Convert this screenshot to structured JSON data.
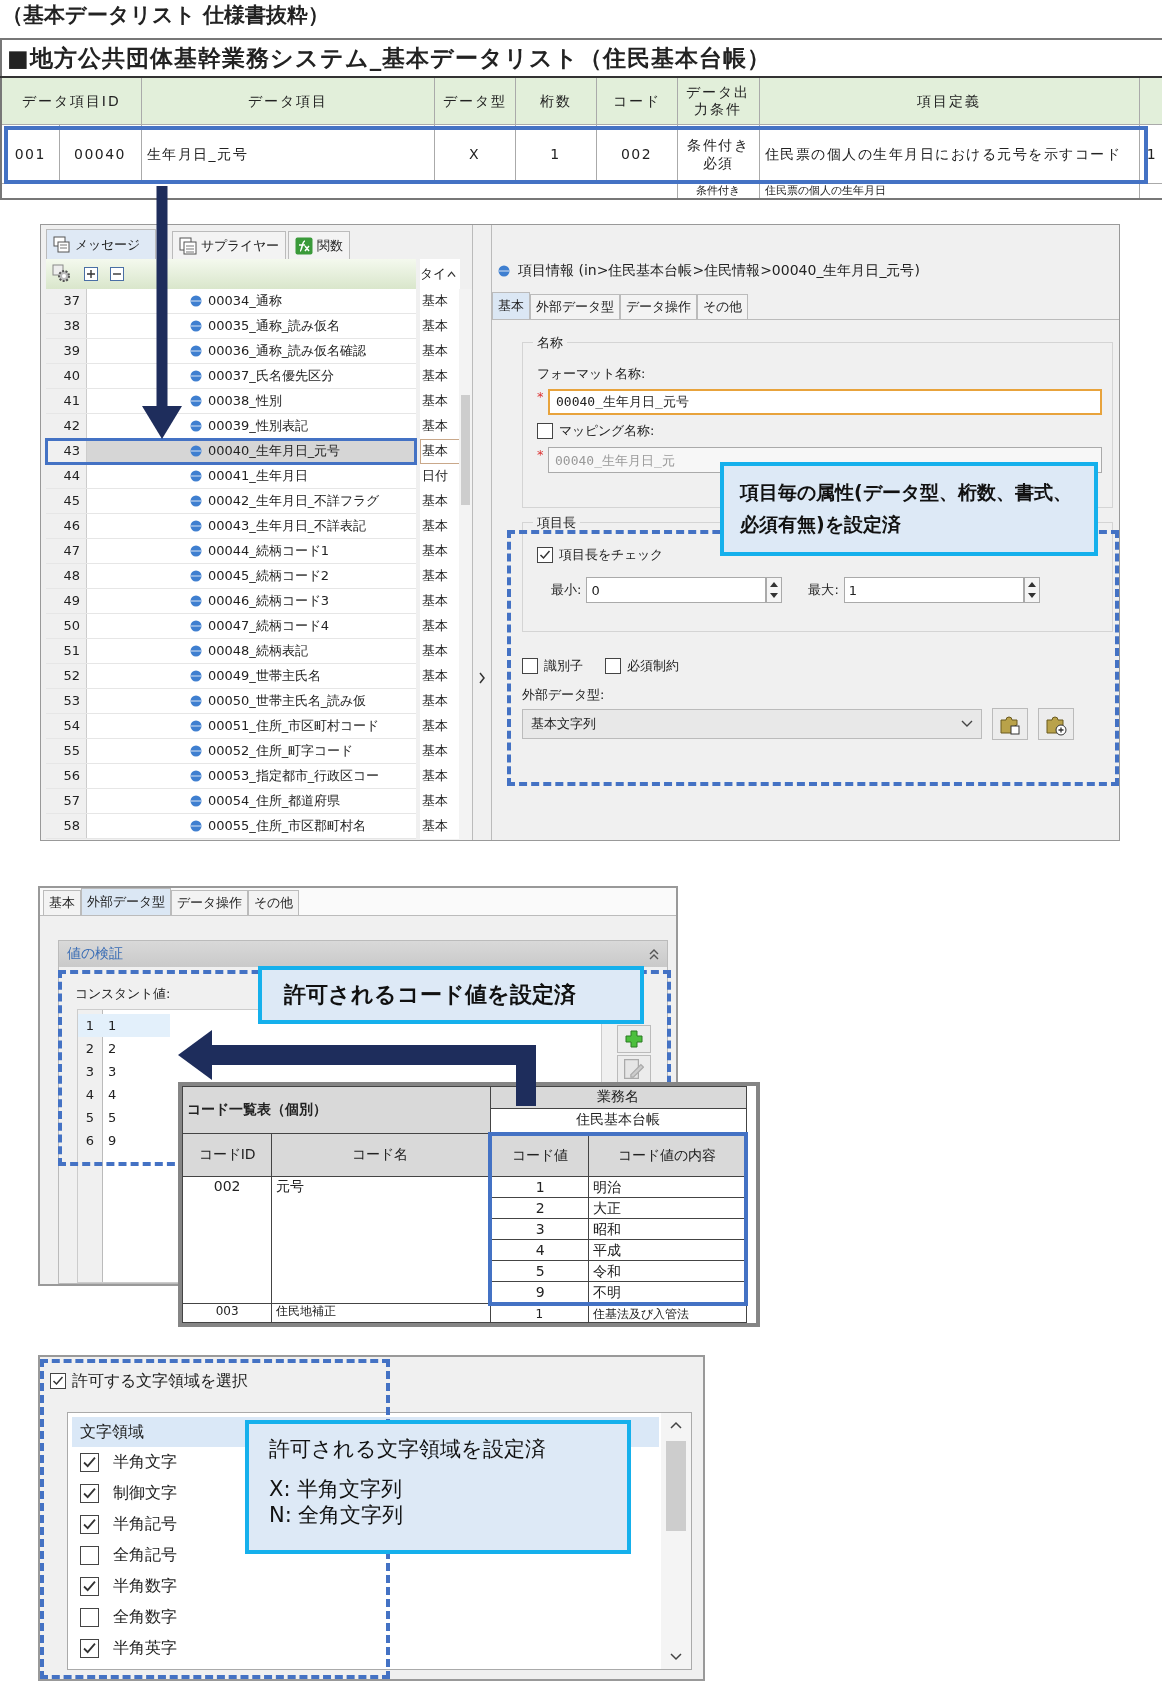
{
  "caption": "（基本データリスト 仕様書抜粋）",
  "spec_table": {
    "title": "■地方公共団体基幹業務システム_基本データリスト（住民基本台帳）",
    "columns": [
      {
        "label": "データ項目ID",
        "colspan": 2
      },
      {
        "label": "データ項目"
      },
      {
        "label": "データ型"
      },
      {
        "label": "桁数"
      },
      {
        "label": "コード"
      },
      {
        "label": "データ出力条件"
      },
      {
        "label": "項目定義"
      }
    ],
    "rows": [
      {
        "cells": [
          "001",
          "00040",
          "生年月日_元号",
          "X",
          "1",
          "002",
          "条件付き必須",
          "住民票の個人の生年月日における元号を示すコード",
          "1"
        ],
        "highlighted": true
      }
    ],
    "next_row": {
      "condition": "条件付き",
      "definition": "住民票の個人の生年月日"
    }
  },
  "editor": {
    "tool_tabs": [
      {
        "label": "メッセージ",
        "selected": true
      },
      {
        "label": "サプライヤー",
        "selected": false
      },
      {
        "label": "関数",
        "selected": false
      }
    ],
    "type_header": "タイ",
    "rows": [
      {
        "number": "37",
        "name": "00034_通称",
        "type": "基本",
        "selected": false
      },
      {
        "number": "38",
        "name": "00035_通称_読み仮名",
        "type": "基本",
        "selected": false
      },
      {
        "number": "39",
        "name": "00036_通称_読み仮名確認",
        "type": "基本",
        "selected": false
      },
      {
        "number": "40",
        "name": "00037_氏名優先区分",
        "type": "基本",
        "selected": false
      },
      {
        "number": "41",
        "name": "00038_性別",
        "type": "基本",
        "selected": false
      },
      {
        "number": "42",
        "name": "00039_性別表記",
        "type": "基本",
        "selected": false
      },
      {
        "number": "43",
        "name": "00040_生年月日_元号",
        "type": "基本",
        "selected": true
      },
      {
        "number": "44",
        "name": "00041_生年月日",
        "type": "日付",
        "selected": false
      },
      {
        "number": "45",
        "name": "00042_生年月日_不詳フラグ",
        "type": "基本",
        "selected": false
      },
      {
        "number": "46",
        "name": "00043_生年月日_不詳表記",
        "type": "基本",
        "selected": false
      },
      {
        "number": "47",
        "name": "00044_続柄コード1",
        "type": "基本",
        "selected": false
      },
      {
        "number": "48",
        "name": "00045_続柄コード2",
        "type": "基本",
        "selected": false
      },
      {
        "number": "49",
        "name": "00046_続柄コード3",
        "type": "基本",
        "selected": false
      },
      {
        "number": "50",
        "name": "00047_続柄コード4",
        "type": "基本",
        "selected": false
      },
      {
        "number": "51",
        "name": "00048_続柄表記",
        "type": "基本",
        "selected": false
      },
      {
        "number": "52",
        "name": "00049_世帯主氏名",
        "type": "基本",
        "selected": false
      },
      {
        "number": "53",
        "name": "00050_世帯主氏名_読み仮",
        "type": "基本",
        "selected": false
      },
      {
        "number": "54",
        "name": "00051_住所_市区町村コード",
        "type": "基本",
        "selected": false
      },
      {
        "number": "55",
        "name": "00052_住所_町字コード",
        "type": "基本",
        "selected": false
      },
      {
        "number": "56",
        "name": "00053_指定都市_行政区コー",
        "type": "基本",
        "selected": false
      },
      {
        "number": "57",
        "name": "00054_住所_都道府県",
        "type": "基本",
        "selected": false
      },
      {
        "number": "58",
        "name": "00055_住所_市区郡町村名",
        "type": "基本",
        "selected": false
      }
    ],
    "item_info": {
      "title": "項目情報 (in>住民基本台帳>住民情報>00040_生年月日_元号)",
      "tabs": [
        {
          "label": "基本",
          "selected": true
        },
        {
          "label": "外部データ型",
          "selected": false
        },
        {
          "label": "データ操作",
          "selected": false
        },
        {
          "label": "その他",
          "selected": false
        }
      ],
      "name_group": "名称",
      "format_label": "フォーマット名称:",
      "format_required_mark": "*",
      "format_value": "00040_生年月日_元号",
      "mapping_label": "マッピング名称:",
      "mapping_checked": false,
      "mapping_required_mark": "*",
      "mapping_value": "00040_生年月日_元",
      "length_group": "項目長",
      "length_check_label": "項目長をチェック",
      "length_checked": true,
      "min_label": "最小:",
      "min_value": "0",
      "max_label": "最大:",
      "max_value": "1",
      "flags": [
        {
          "label": "識別子",
          "checked": false
        },
        {
          "label": "必須制約",
          "checked": false
        }
      ],
      "external_type_label": "外部データ型:",
      "external_type_value": "基本文字列"
    },
    "callout": "項目毎の属性(データ型、桁数、書式、必須有無)を設定済"
  },
  "validation": {
    "tabs": [
      {
        "label": "基本",
        "selected": false
      },
      {
        "label": "外部データ型",
        "selected": true
      },
      {
        "label": "データ操作",
        "selected": false
      },
      {
        "label": "その他",
        "selected": false
      }
    ],
    "group_title": "値の検証",
    "constant_label": "コンスタント値:",
    "constants": [
      {
        "number": "1",
        "value": "1",
        "selected": true
      },
      {
        "number": "2",
        "value": "2",
        "selected": false
      },
      {
        "number": "3",
        "value": "3",
        "selected": false
      },
      {
        "number": "4",
        "value": "4",
        "selected": false
      },
      {
        "number": "5",
        "value": "5",
        "selected": false
      },
      {
        "number": "6",
        "value": "9",
        "selected": false
      }
    ],
    "callout": "許可されるコード値を設定済",
    "code_table": {
      "title": "コード一覧表（個別）",
      "business_label": "業務名",
      "business_value": "住民基本台帳",
      "columns": [
        "コードID",
        "コード名",
        "コード値",
        "コード値の内容"
      ],
      "groups": [
        {
          "id": "002",
          "name": "元号",
          "highlighted": true,
          "values": [
            {
              "code": "1",
              "meaning": "明治"
            },
            {
              "code": "2",
              "meaning": "大正"
            },
            {
              "code": "3",
              "meaning": "昭和"
            },
            {
              "code": "4",
              "meaning": "平成"
            },
            {
              "code": "5",
              "meaning": "令和"
            },
            {
              "code": "9",
              "meaning": "不明"
            }
          ]
        },
        {
          "id": "003",
          "name": "住民地補正",
          "highlighted": false,
          "values": [
            {
              "code": "1",
              "meaning": "住基法及び入管法"
            }
          ]
        }
      ]
    }
  },
  "char_filter": {
    "select_label": "許可する文字領域を選択",
    "select_checked": true,
    "list_header": "文字領域",
    "items": [
      {
        "label": "半角文字",
        "checked": true
      },
      {
        "label": "制御文字",
        "checked": true
      },
      {
        "label": "半角記号",
        "checked": true
      },
      {
        "label": "全角記号",
        "checked": false
      },
      {
        "label": "半角数字",
        "checked": true
      },
      {
        "label": "全角数字",
        "checked": false
      },
      {
        "label": "半角英字",
        "checked": true
      }
    ],
    "callout": [
      "許可される文字領域を設定済",
      "X: 半角文字列",
      "N: 全角文字列"
    ]
  }
}
